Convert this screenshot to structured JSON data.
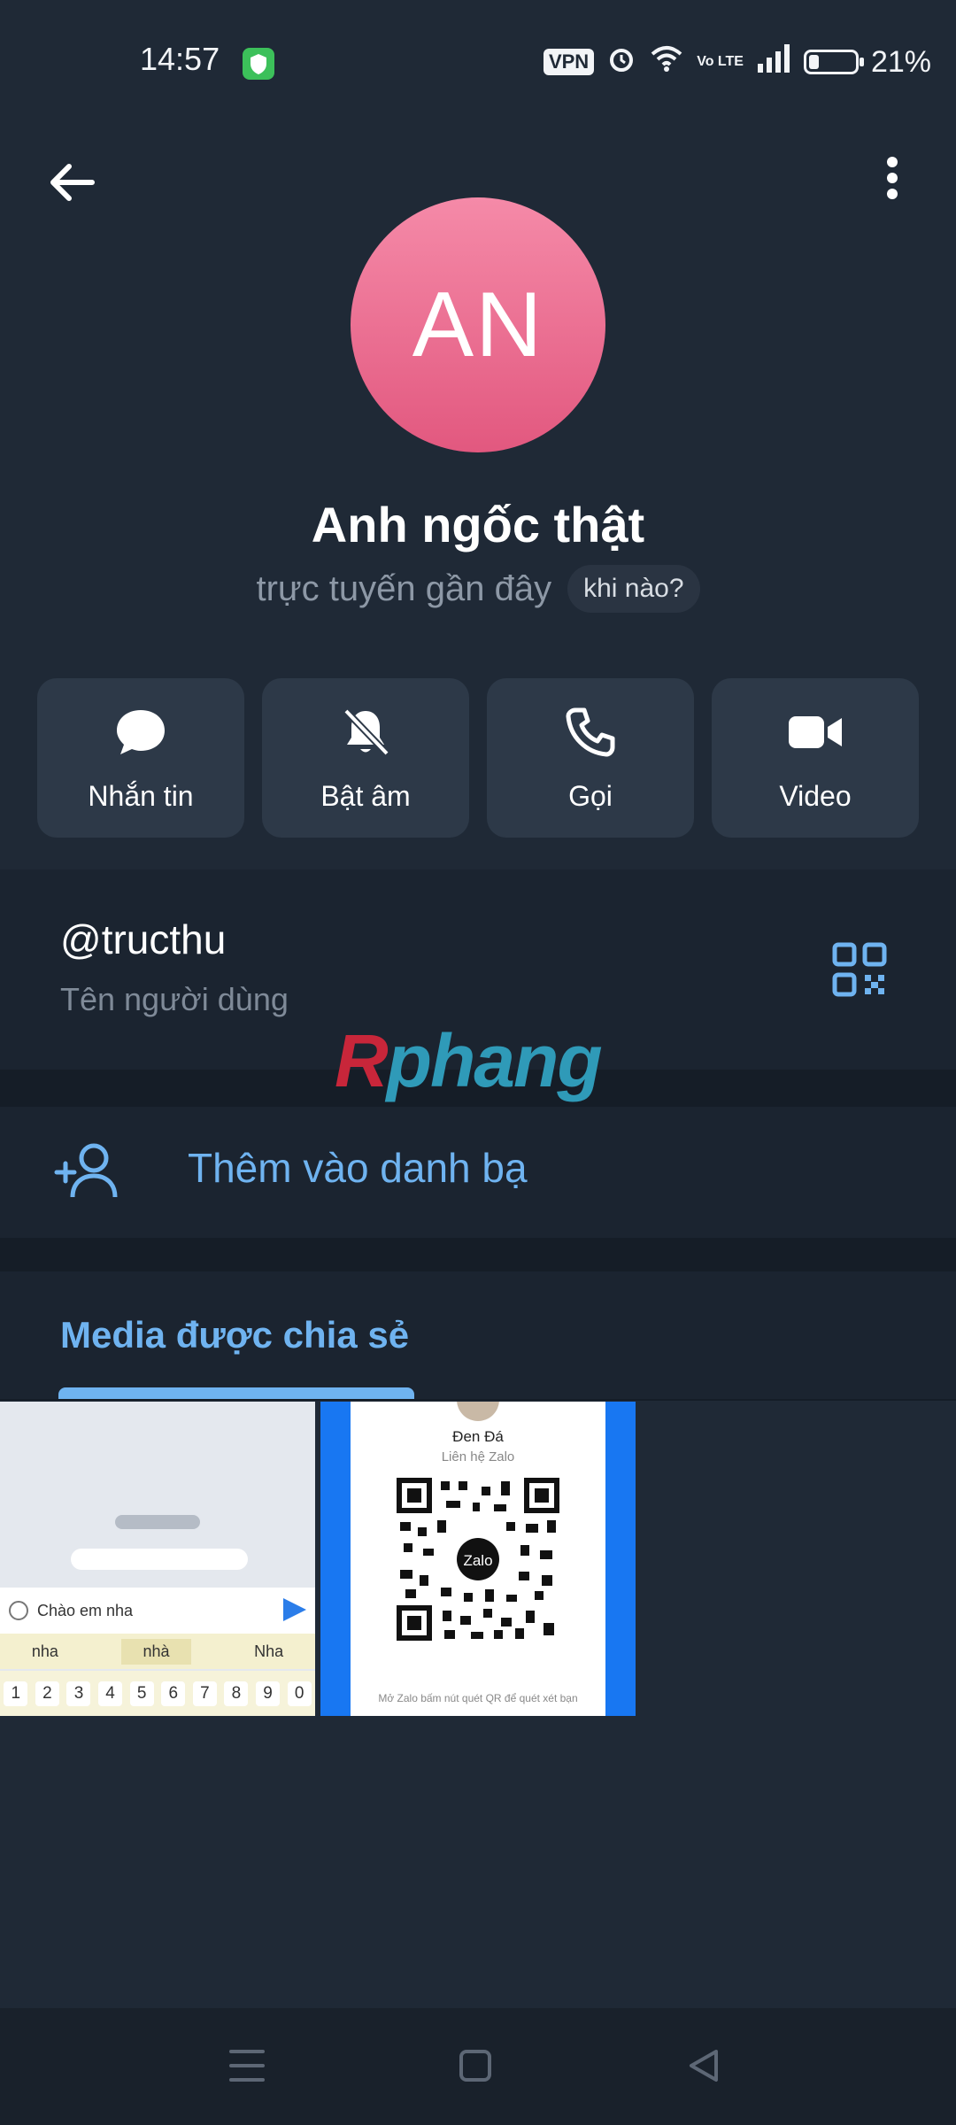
{
  "status_bar": {
    "time": "14:57",
    "vpn": "VPN",
    "volte": "Vo LTE",
    "battery": "21%",
    "battery_level_percent": 21
  },
  "profile": {
    "avatar_initials": "AN",
    "name": "Anh ngốc thật",
    "last_seen": "trực tuyến gần đây",
    "when_button": "khi nào?"
  },
  "actions": [
    {
      "label": "Nhắn tin",
      "icon": "chat-icon"
    },
    {
      "label": "Bật âm",
      "icon": "bell-off-icon"
    },
    {
      "label": "Gọi",
      "icon": "phone-icon"
    },
    {
      "label": "Video",
      "icon": "video-camera-icon"
    }
  ],
  "username": {
    "value": "@tructhu",
    "label": "Tên người dùng"
  },
  "watermark": {
    "first": "R",
    "rest": "phang"
  },
  "add_contact": {
    "label": "Thêm vào danh bạ"
  },
  "media": {
    "title": "Media được chia sẻ",
    "thumb1": {
      "input_text": "Chào em nha",
      "suggestions": [
        "nha",
        "nhà",
        "Nha"
      ],
      "keys": [
        "1",
        "2",
        "3",
        "4",
        "5",
        "6",
        "7",
        "8",
        "9",
        "0"
      ]
    },
    "thumb2": {
      "name": "Đen Đá",
      "subtitle": "Liên hệ Zalo",
      "logo": "Zalo",
      "footer": "Mở Zalo bấm nút quét QR để quét xét bạn"
    }
  },
  "colors": {
    "background": "#1f2936",
    "accent": "#6fb3f0",
    "avatar": "#e96a8f"
  }
}
